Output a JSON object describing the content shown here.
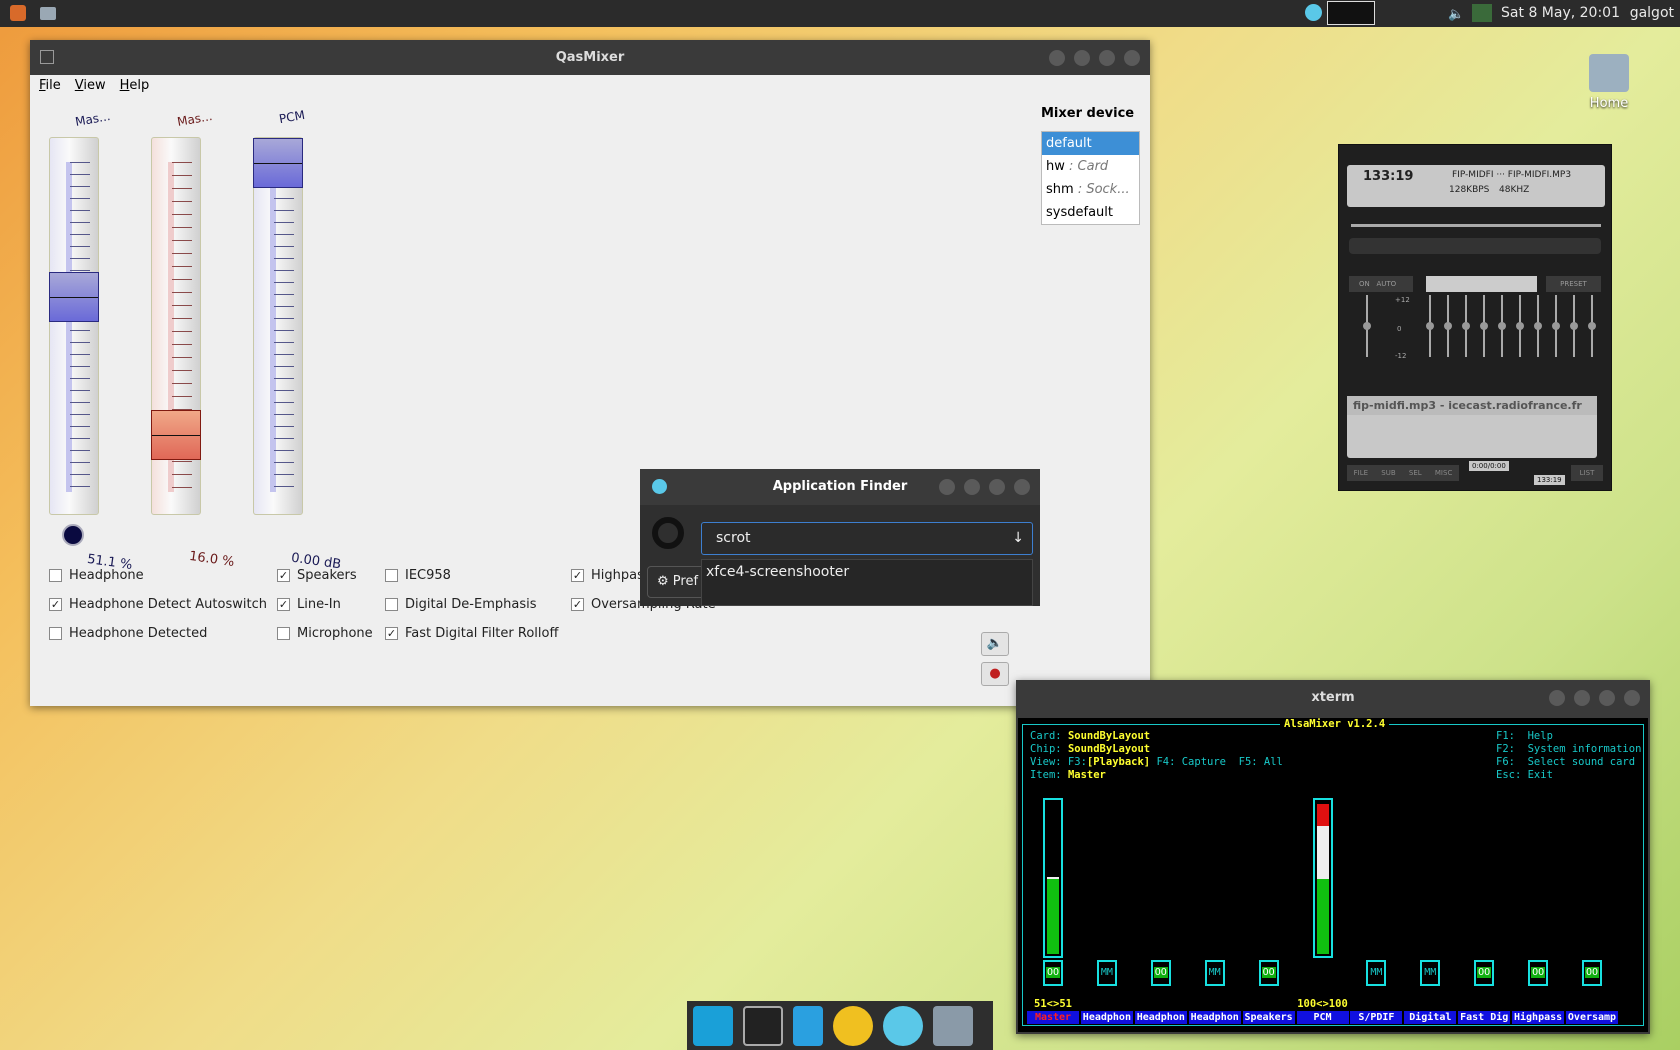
{
  "top_panel": {
    "clock": "Sat  8 May, 20:01",
    "user": "galgot"
  },
  "desktop": {
    "home_label": "Home"
  },
  "qasmixer": {
    "title": "QasMixer",
    "menu": [
      "File",
      "View",
      "Help"
    ],
    "sliders": [
      {
        "label": "Mas...",
        "value": "51.1 %",
        "level": 0.511,
        "color": "blue"
      },
      {
        "label": "Mas...",
        "value": "16.0 %",
        "level": 0.16,
        "color": "red"
      },
      {
        "label": "PCM",
        "value": "0.00 dB",
        "level": 1.0,
        "color": "blue"
      }
    ],
    "mixer_device_label": "Mixer device",
    "devices": [
      {
        "name": "default",
        "desc": ""
      },
      {
        "name": "hw",
        "desc": " : Card"
      },
      {
        "name": "shm",
        "desc": " : Sock..."
      },
      {
        "name": "sysdefault",
        "desc": ""
      }
    ],
    "switches": [
      {
        "label": "Headphone",
        "checked": false
      },
      {
        "label": "Headphone Detect Autoswitch",
        "checked": true
      },
      {
        "label": "Headphone Detected",
        "checked": false
      },
      {
        "label": "Speakers",
        "checked": true
      },
      {
        "label": "Line-In",
        "checked": true
      },
      {
        "label": "Microphone",
        "checked": false
      },
      {
        "label": "IEC958",
        "checked": false
      },
      {
        "label": "Digital De-Emphasis",
        "checked": false
      },
      {
        "label": "Fast Digital Filter Rolloff",
        "checked": true
      },
      {
        "label": "Highpass Filter",
        "checked": true
      },
      {
        "label": "Oversampling Rate",
        "checked": true
      }
    ]
  },
  "app_finder": {
    "title": "Application Finder",
    "query": "scrot",
    "result": "xfce4-screenshooter",
    "pref_label": "Pref"
  },
  "player": {
    "time": "133:19",
    "title": "FIP-MIDFI ··· FIP-MIDFI.MP3",
    "bitrate": "128KBPS",
    "rate": "48KHZ",
    "eq_on": "ON",
    "eq_auto": "AUTO",
    "preset": "PRESET",
    "eq_plus": "+12",
    "eq_zero": "0",
    "eq_minus": "-12",
    "playlist_item": "fip-midfi.mp3 - icecast.radiofrance.fr",
    "pl_time": "0:00/0:00",
    "pl_total": "133:19",
    "pl_buttons": [
      "FILE",
      "SUB",
      "SEL",
      "MISC"
    ],
    "list": "LIST"
  },
  "xterm": {
    "title": "xterm",
    "header": "AlsaMixer v1.2.4",
    "card_label": "Card: ",
    "card": "SoundByLayout",
    "chip_label": "Chip: ",
    "chip": "SoundByLayout",
    "view_label": "View: F3:",
    "view_sel": "[Playback]",
    "view_rest": " F4: Capture  F5: All",
    "item_label": "Item: ",
    "item": "Master",
    "help": [
      "F1:  Help",
      "F2:  System information",
      "F6:  Select sound card",
      "Esc: Exit"
    ],
    "controls": [
      {
        "name": "Master",
        "mute": "OO",
        "value": "51<>51",
        "level": 51
      },
      {
        "name": "Headphon",
        "mute": "MM"
      },
      {
        "name": "Headphon",
        "mute": "OO"
      },
      {
        "name": "Headphon",
        "mute": "MM"
      },
      {
        "name": "Speakers",
        "mute": "OO"
      },
      {
        "name": "PCM",
        "value": "100<>100",
        "level": 100
      },
      {
        "name": "S/PDIF",
        "mute": "MM"
      },
      {
        "name": "Digital",
        "mute": "MM"
      },
      {
        "name": "Fast Dig",
        "mute": "OO"
      },
      {
        "name": "Highpass",
        "mute": "OO"
      },
      {
        "name": "Oversamp",
        "mute": "OO"
      }
    ]
  }
}
